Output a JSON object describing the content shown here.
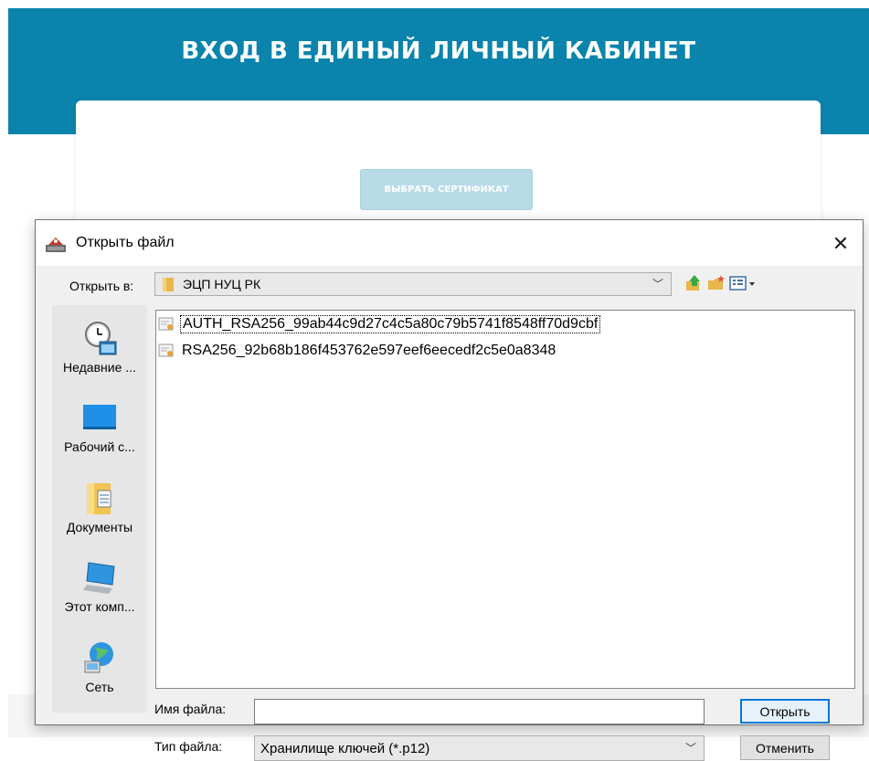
{
  "page": {
    "title": "ВХОД В ЕДИНЫЙ ЛИЧНЫЙ КАБИНЕТ",
    "cert_button_label": "ВЫБРАТЬ СЕРТИФИКАТ",
    "banner_color": "#0a84ad"
  },
  "dialog": {
    "title": "Открыть файл",
    "close_label": "✕",
    "look_in_label": "Открыть в:",
    "look_in_value": "ЭЦП НУЦ РК",
    "toolbar": [
      {
        "name": "up-folder-icon"
      },
      {
        "name": "new-folder-icon"
      },
      {
        "name": "view-menu-icon"
      }
    ],
    "places": [
      {
        "label": "Недавние ...",
        "icon": "recent-items-icon"
      },
      {
        "label": "Рабочий с...",
        "icon": "desktop-icon"
      },
      {
        "label": "Документы",
        "icon": "documents-icon"
      },
      {
        "label": "Этот комп...",
        "icon": "this-computer-icon"
      },
      {
        "label": "Сеть",
        "icon": "network-icon"
      }
    ],
    "files": [
      {
        "name": "AUTH_RSA256_99ab44c9d27c4c5a80c79b5741f8548ff70d9cbf",
        "icon": "certificate-file-icon"
      },
      {
        "name": "RSA256_92b68b186f453762e597eef6eecedf2c5e0a8348",
        "icon": "certificate-file-icon"
      }
    ],
    "file_name_label": "Имя файла:",
    "file_name_value": "",
    "file_type_label": "Тип файла:",
    "file_type_value": "Хранилище ключей (*.p12)",
    "open_button": "Открыть",
    "cancel_button": "Отменить"
  }
}
